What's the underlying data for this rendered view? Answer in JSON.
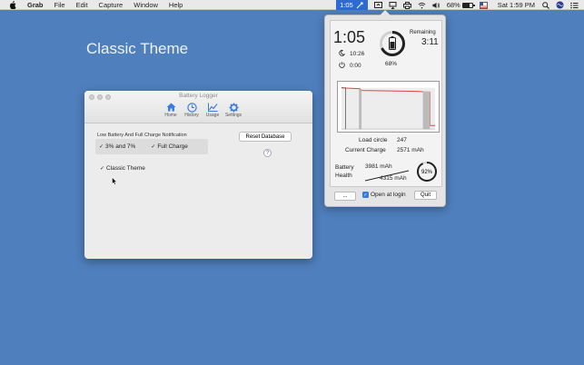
{
  "menubar": {
    "app_name": "Grab",
    "menus": [
      "File",
      "Edit",
      "Capture",
      "Window",
      "Help"
    ],
    "battery_time": "1:05",
    "battery_percent": "68%",
    "clock": "Sat 1:59 PM"
  },
  "desktop": {
    "title": "Classic Theme"
  },
  "settings_window": {
    "title": "Battery Logger",
    "tabs": [
      "Home",
      "History",
      "Usage",
      "Settings"
    ],
    "notif_label": "Low Battery And Full Charge Notification",
    "opt_low": "3% and 7%",
    "opt_full": "Full Charge",
    "reset_label": "Reset Database",
    "help_label": "?",
    "classic_label": "Classic Theme",
    "check_mark": "✓"
  },
  "popover": {
    "time": "1:05",
    "sleep_time": "10:26",
    "power_time": "0:00",
    "percent": "68%",
    "remaining_label": "Remaining",
    "remaining_value": "3:11",
    "load_circle_label": "Load circle",
    "load_circle_value": "247",
    "current_charge_label": "Current Charge",
    "current_charge_value": "2571 mAh",
    "health_label_1": "Battery",
    "health_label_2": "Health",
    "design_capacity": "3981 mAh",
    "full_capacity": "4315 mAh",
    "health_percent": "92%",
    "dots_label": "...",
    "login_label": "Open at login",
    "quit_label": "Quit",
    "check_mark": "✓"
  },
  "colors": {
    "desktop_blue": "#4f7fbd",
    "accent_blue": "#3a7be0",
    "graph_red": "#e0454a"
  },
  "gauges": {
    "charge_fraction": 0.68,
    "health_fraction": 0.92
  }
}
